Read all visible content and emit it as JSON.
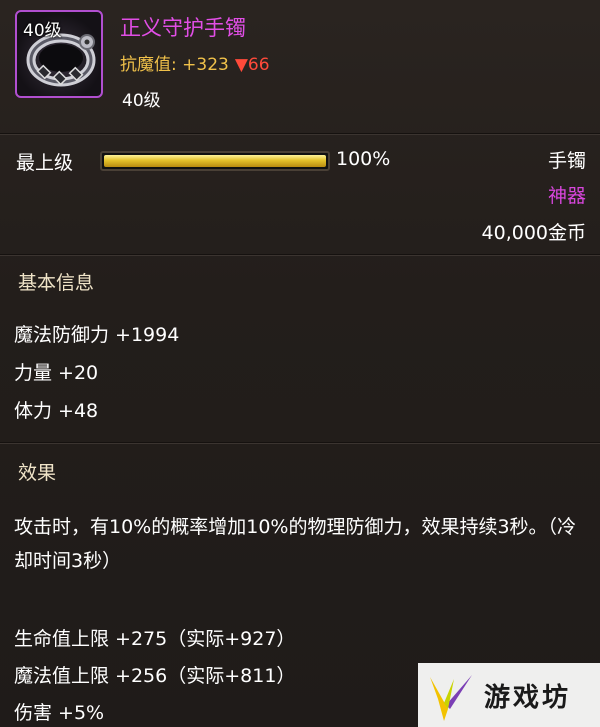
{
  "item": {
    "icon_level": "40级",
    "name": "正义守护手镯",
    "resist_label": "抗魔值: +323",
    "resist_delta": "▼66",
    "level": "40级",
    "icon": "bracelet-icon"
  },
  "upgrade": {
    "label": "最上级",
    "progress_fraction": 1.0,
    "percent_text": "100%"
  },
  "slot": "手镯",
  "grade": "神器",
  "price": "40,000金币",
  "basic": {
    "title": "基本信息",
    "stats": [
      "魔法防御力 +1994",
      "力量 +20",
      "体力 +48"
    ]
  },
  "effect": {
    "title": "效果",
    "description": "攻击时，有10%的概率增加10%的物理防御力，效果持续3秒。（冷却时间3秒）",
    "stats": [
      "生命值上限 +275（实际+927）",
      "魔法值上限 +256（实际+811）",
      "伤害 +5%"
    ]
  },
  "watermark": {
    "text": "游戏坊"
  },
  "colors": {
    "name": "#e14ee6",
    "resist": "#f0c14a",
    "resist_down": "#ff4a3a",
    "grade": "#d846dd",
    "bar_fill": "#e4c12a",
    "background": "#241f1d"
  }
}
